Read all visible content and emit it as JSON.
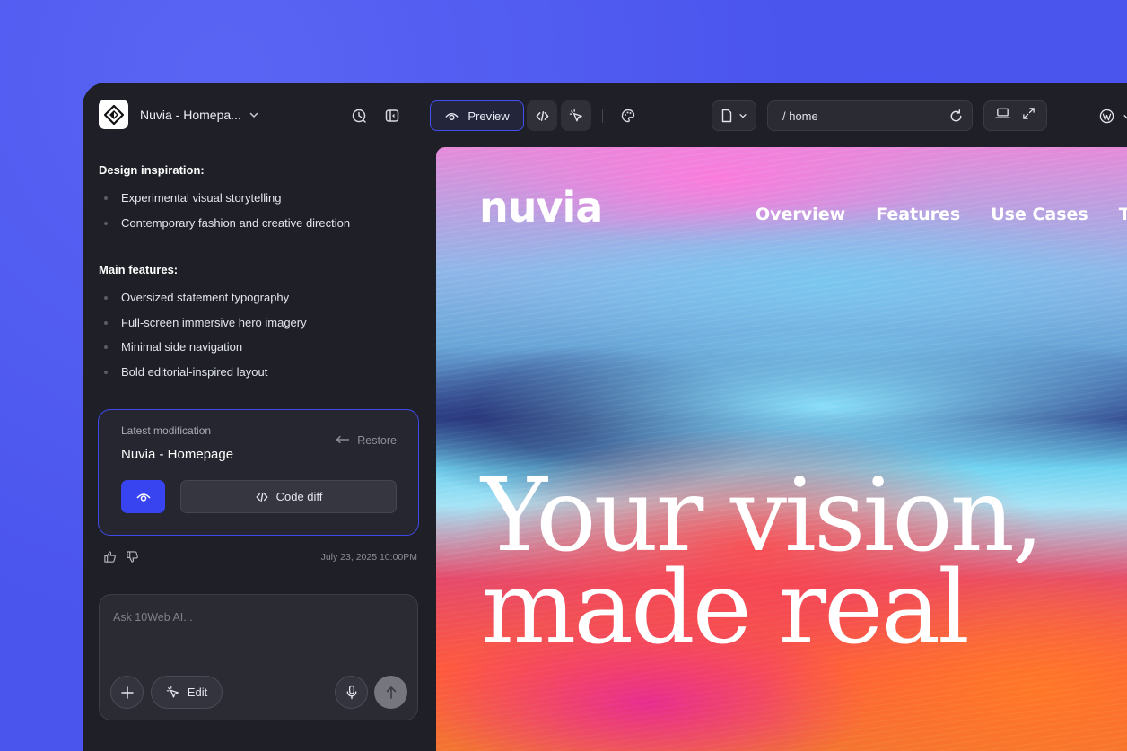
{
  "colors": {
    "accent": "#3844f0",
    "panel_bg": "#1f2027",
    "backdrop": "#4a55ee"
  },
  "topbar": {
    "project_name": "Nuvia - Homepa...",
    "preview_label": "Preview",
    "url": "/ home",
    "icons": [
      "history-icon",
      "sidebar-toggle-icon",
      "eye-icon",
      "code-icon",
      "cursor-select-icon",
      "palette-icon",
      "page-icon",
      "refresh-icon",
      "laptop-icon",
      "expand-icon",
      "wordpress-icon"
    ]
  },
  "panel": {
    "inspiration_title": "Design inspiration:",
    "inspiration_items": [
      "Experimental visual storytelling",
      "Contemporary fashion and creative direction"
    ],
    "features_title": "Main features:",
    "features_items": [
      "Oversized statement typography",
      "Full-screen immersive hero imagery",
      "Minimal side navigation",
      "Bold editorial-inspired layout"
    ],
    "modification": {
      "label": "Latest modification",
      "name": "Nuvia - Homepage",
      "restore_label": "Restore",
      "code_diff_label": "Code diff"
    },
    "date": "July 23, 2025 10:00PM",
    "ask": {
      "placeholder": "Ask 10Web AI...",
      "edit_label": "Edit"
    }
  },
  "site": {
    "logo": "nuvia",
    "nav": [
      "Overview",
      "Features",
      "Use Cases",
      "Testi"
    ],
    "hero_line1": "Your vision,",
    "hero_line2": "made real"
  }
}
